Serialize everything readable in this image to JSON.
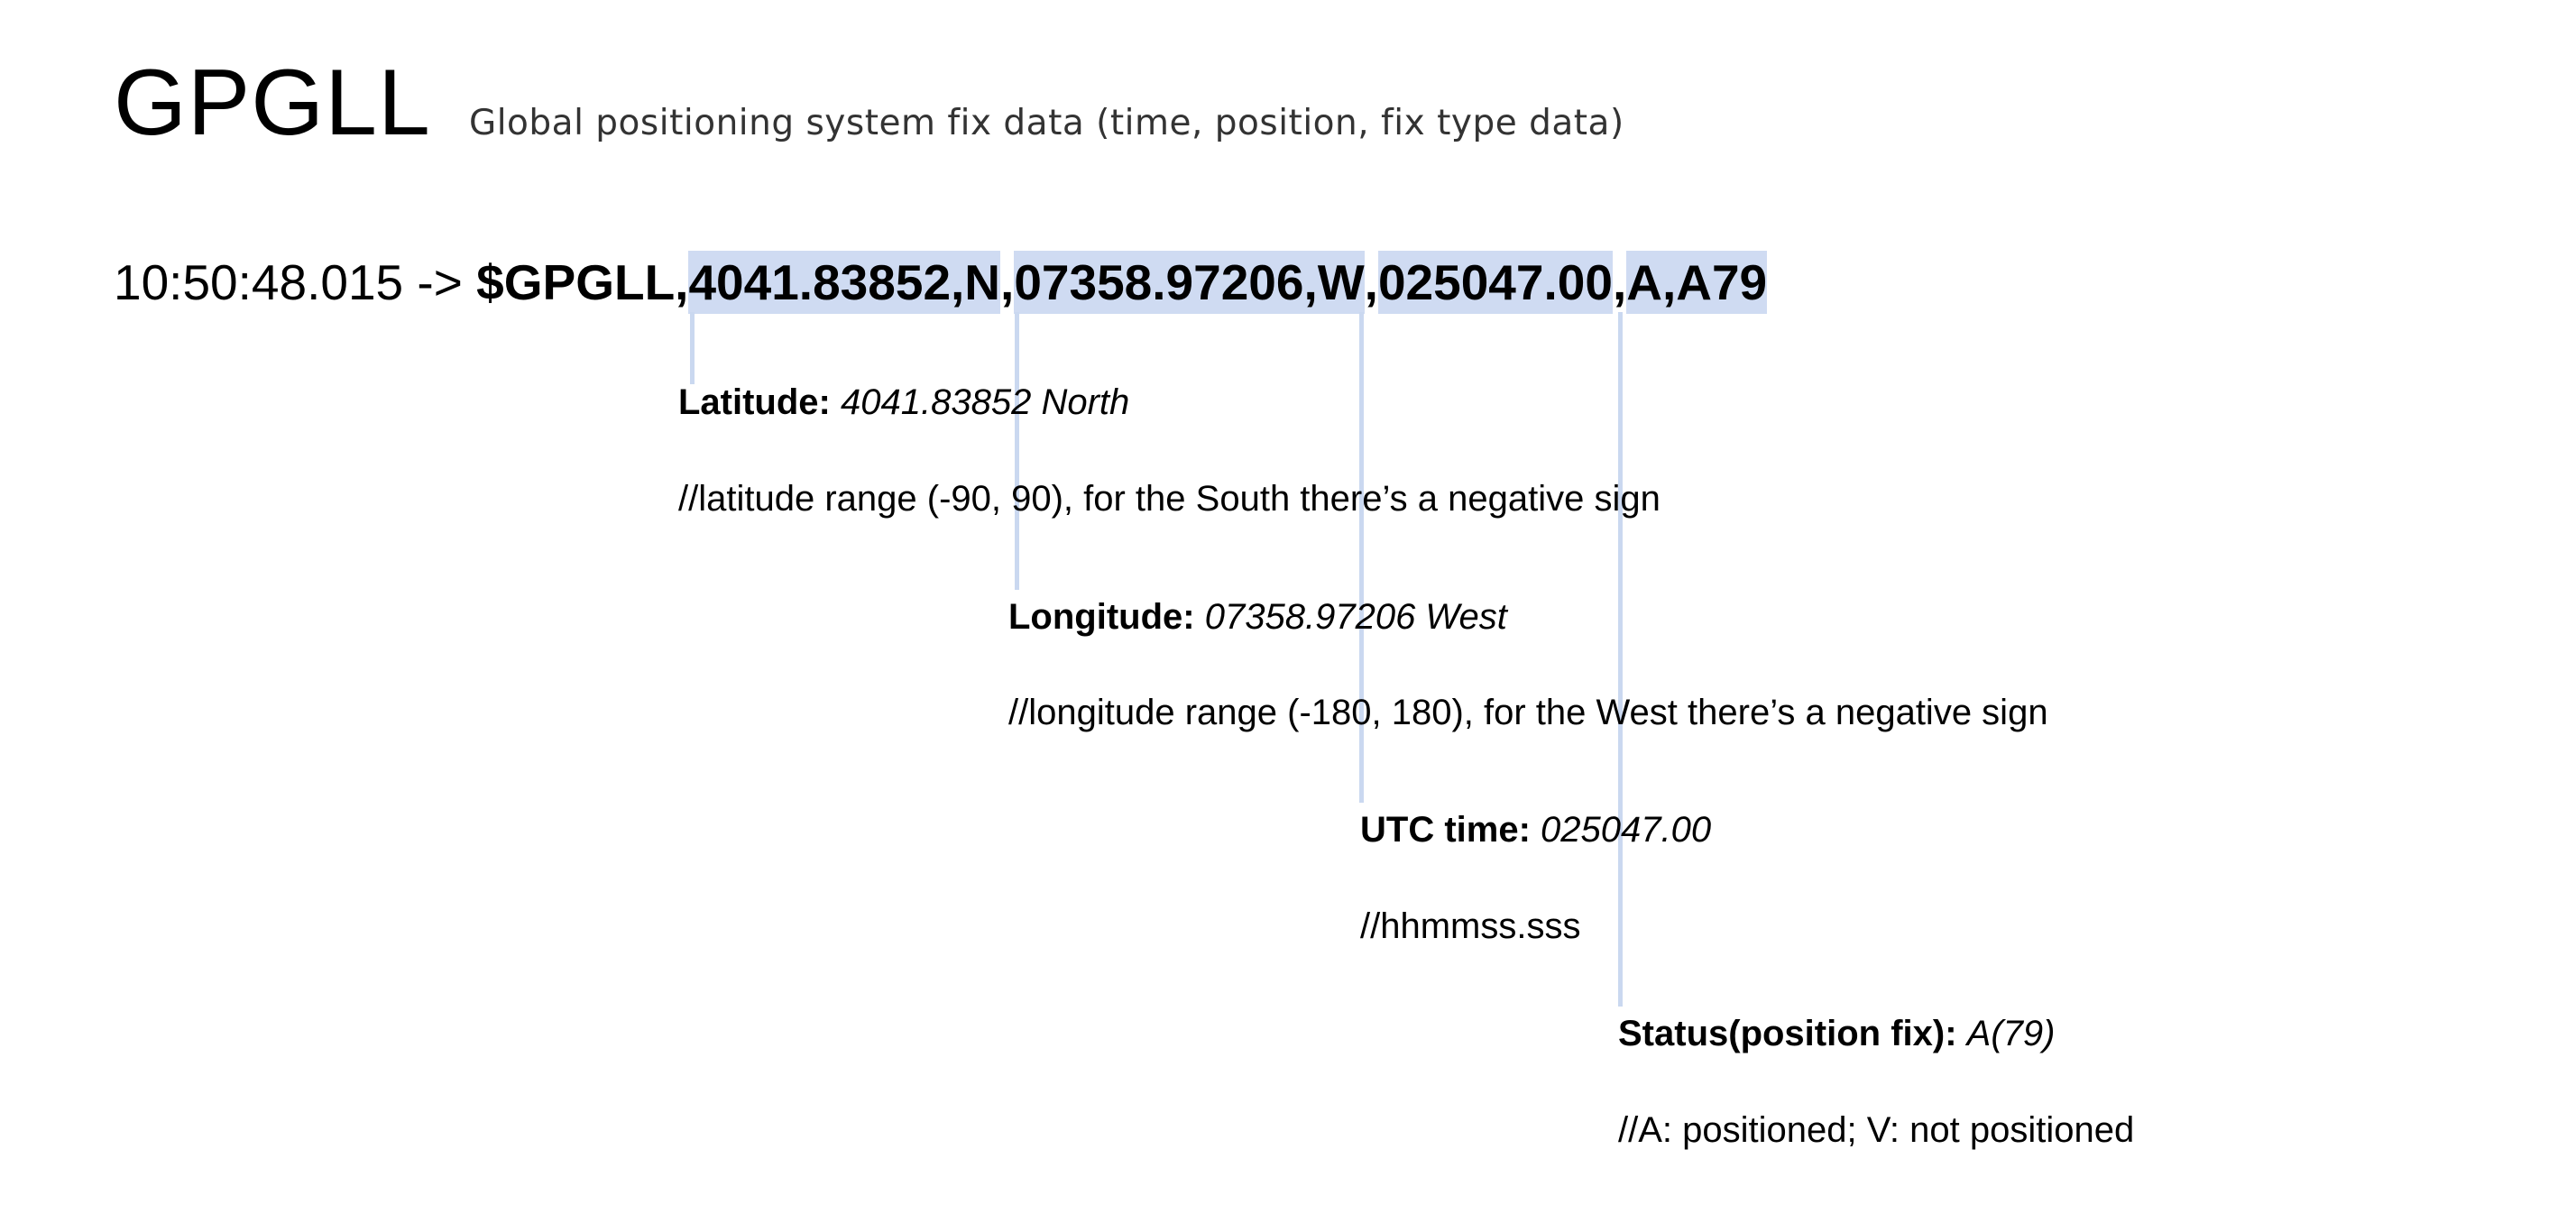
{
  "header": {
    "title": "GPGLL",
    "subtitle": "Global positioning system fix data (time, position, fix type data)"
  },
  "sentence": {
    "timestamp_prefix": "10:50:48.015 -> ",
    "talker": "$GPGLL,",
    "latitude_field": "4041.83852,N",
    "sep1": ",",
    "longitude_field": "07358.97206,W",
    "sep2": ",",
    "utc_field": "025047.00",
    "sep3": ",",
    "status_field": "A,A79"
  },
  "annotations": {
    "latitude": {
      "label": "Latitude:",
      "value": "4041.83852 North",
      "note": "//latitude range (-90, 90), for the South there’s a negative sign"
    },
    "longitude": {
      "label": "Longitude:",
      "value": "07358.97206 West",
      "note": "//longitude range (-180, 180), for the West there’s a negative sign"
    },
    "utc_time": {
      "label": "UTC time:",
      "value": "025047.00",
      "note": "//hhmmss.sss"
    },
    "status": {
      "label": "Status(position fix):",
      "value": "A(79)",
      "note": "//A: positioned; V: not positioned"
    }
  },
  "colors": {
    "highlight": "#cfdbf2",
    "leader_line": "#cad8f0"
  }
}
